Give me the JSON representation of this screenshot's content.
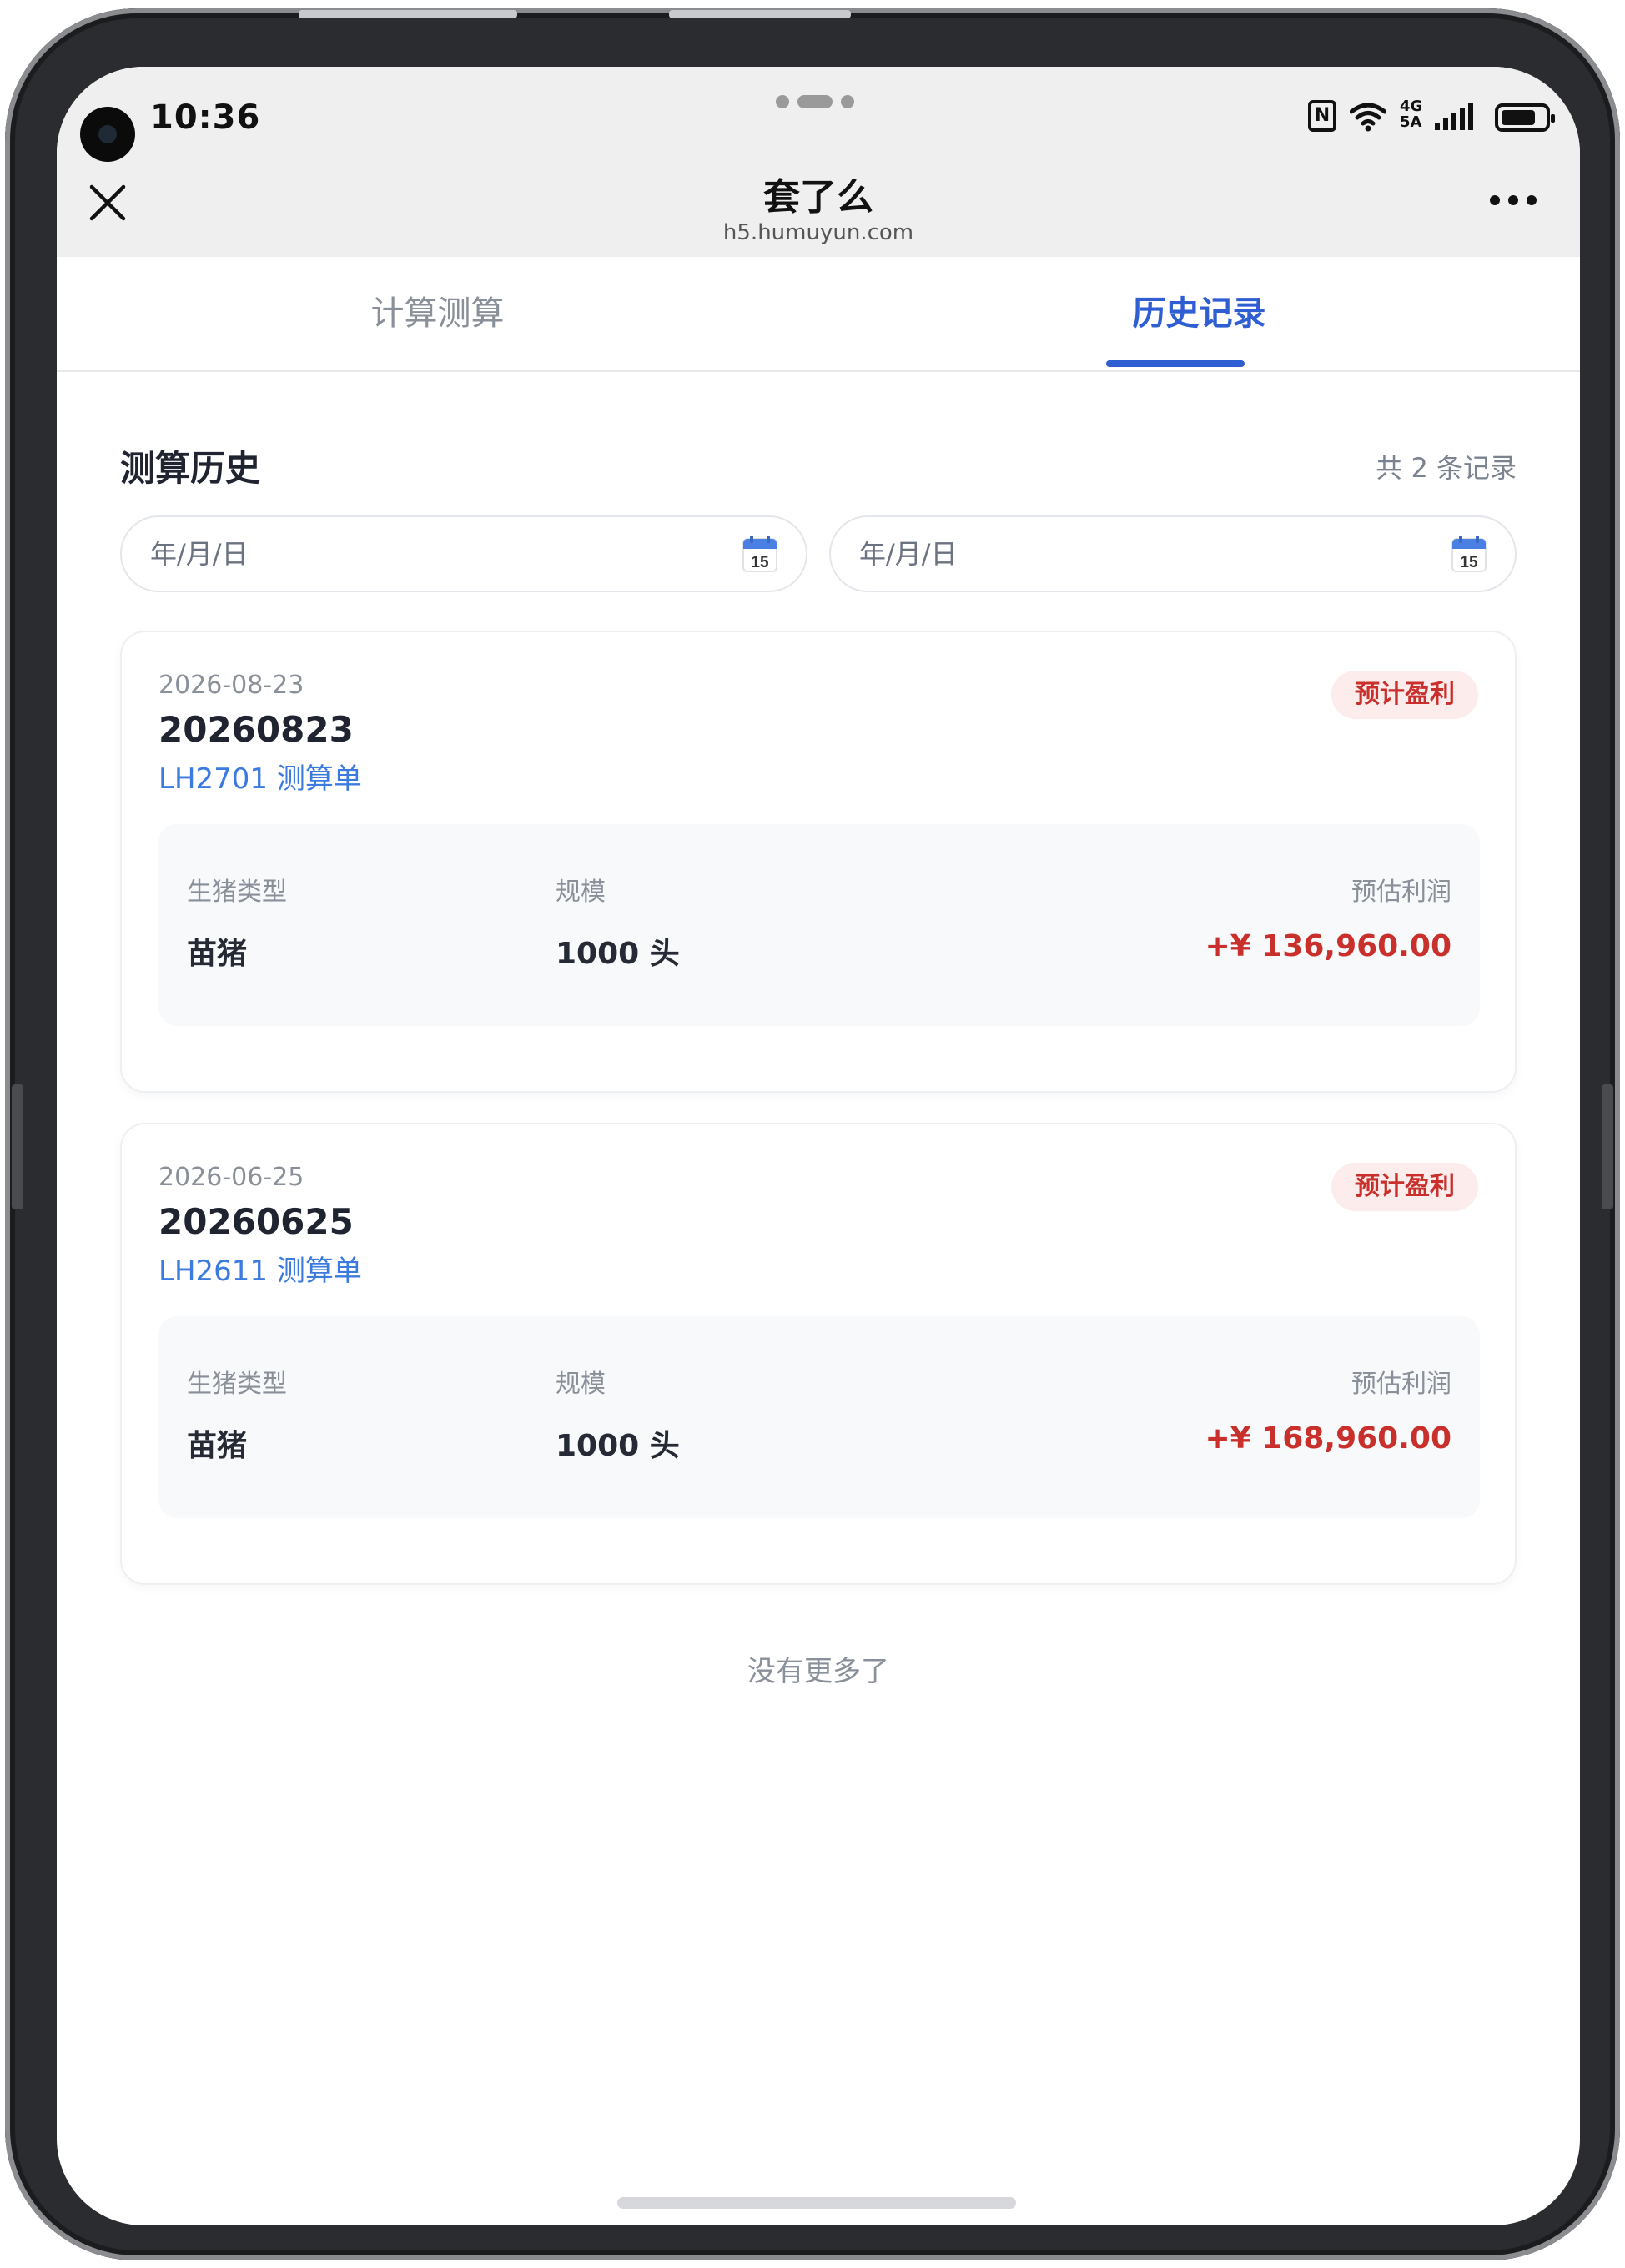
{
  "status_bar": {
    "time": "10:36",
    "network_top": "4G",
    "network_bottom": "5A",
    "icons": [
      "nfc-icon",
      "wifi-icon",
      "signal-icon",
      "battery-icon"
    ]
  },
  "browser": {
    "title": "套了么",
    "url": "h5.humuyun.com",
    "close_icon": "close-icon",
    "more_icon": "more-icon"
  },
  "tabs": [
    {
      "label": "计算测算",
      "active": false
    },
    {
      "label": "历史记录",
      "active": true
    }
  ],
  "history": {
    "title": "测算历史",
    "count_text": "共 2 条记录",
    "start_date_placeholder": "年/月/日",
    "end_date_placeholder": "年/月/日",
    "calendar_day": "15",
    "records": [
      {
        "date": "2026-08-23",
        "id": "20260823",
        "subtitle": "LH2701 测算单",
        "badge": "预计盈利",
        "type_label": "生猪类型",
        "type_value": "苗猪",
        "scale_label": "规模",
        "scale_value": "1000 头",
        "profit_label": "预估利润",
        "profit_value": "+¥ 136,960.00"
      },
      {
        "date": "2026-06-25",
        "id": "20260625",
        "subtitle": "LH2611 测算单",
        "badge": "预计盈利",
        "type_label": "生猪类型",
        "type_value": "苗猪",
        "scale_label": "规模",
        "scale_value": "1000 头",
        "profit_label": "预估利润",
        "profit_value": "+¥ 168,960.00"
      }
    ],
    "end_text": "没有更多了"
  },
  "colors": {
    "accent": "#2f5ed3",
    "link": "#3b7be0",
    "profit": "#c9302c",
    "badge_bg": "#fdecec"
  }
}
